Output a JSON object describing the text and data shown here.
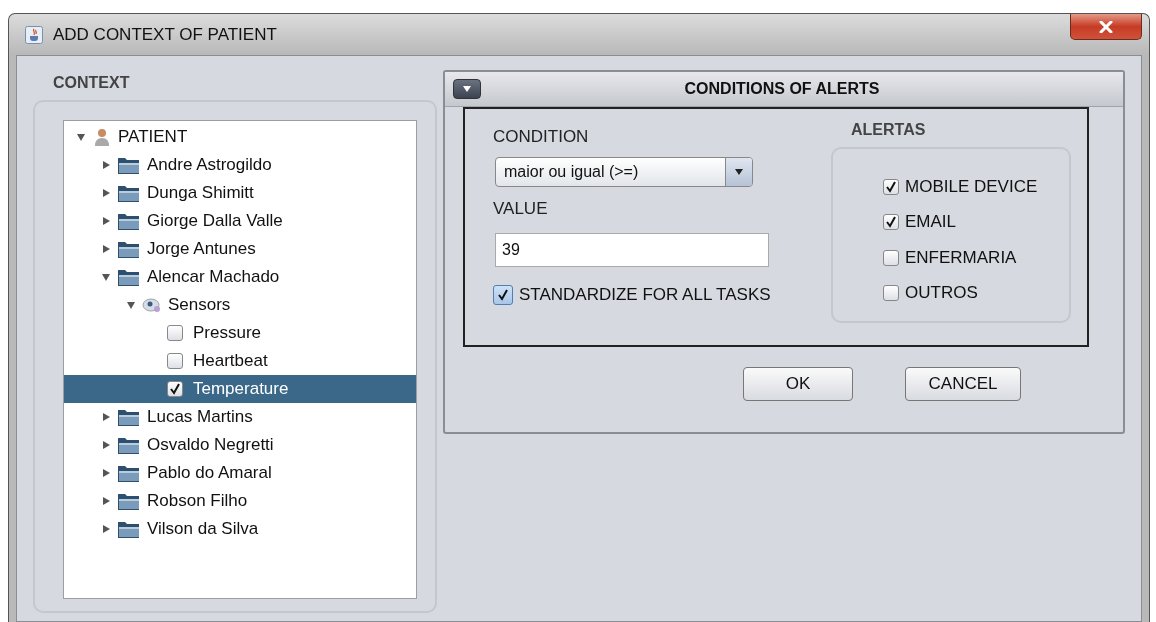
{
  "window": {
    "title": "ADD CONTEXT OF PATIENT"
  },
  "context": {
    "title": "CONTEXT",
    "tree": [
      {
        "label": "PATIENT",
        "kind": "root",
        "expanded": true,
        "selected": false,
        "children": [
          {
            "label": "Andre Astrogildo",
            "kind": "folder",
            "expanded": false,
            "selected": false
          },
          {
            "label": "Dunga Shimitt",
            "kind": "folder",
            "expanded": false,
            "selected": false
          },
          {
            "label": "Giorge Dalla Valle",
            "kind": "folder",
            "expanded": false,
            "selected": false
          },
          {
            "label": "Jorge Antunes",
            "kind": "folder",
            "expanded": false,
            "selected": false
          },
          {
            "label": "Alencar Machado",
            "kind": "folder",
            "expanded": true,
            "selected": false,
            "children": [
              {
                "label": "Sensors",
                "kind": "sensors",
                "expanded": true,
                "selected": false,
                "children": [
                  {
                    "label": "Pressure",
                    "kind": "check",
                    "checked": false,
                    "selected": false
                  },
                  {
                    "label": "Heartbeat",
                    "kind": "check",
                    "checked": false,
                    "selected": false
                  },
                  {
                    "label": "Temperature",
                    "kind": "check",
                    "checked": true,
                    "selected": true
                  }
                ]
              }
            ]
          },
          {
            "label": "Lucas Martins",
            "kind": "folder",
            "expanded": false,
            "selected": false
          },
          {
            "label": "Osvaldo Negretti",
            "kind": "folder",
            "expanded": false,
            "selected": false
          },
          {
            "label": "Pablo do Amaral",
            "kind": "folder",
            "expanded": false,
            "selected": false
          },
          {
            "label": "Robson Filho",
            "kind": "folder",
            "expanded": false,
            "selected": false
          },
          {
            "label": "Vilson da Silva",
            "kind": "folder",
            "expanded": false,
            "selected": false
          }
        ]
      }
    ]
  },
  "alerts_panel": {
    "title": "CONDITIONS OF ALERTS",
    "condition_label": "CONDITION",
    "condition": "maior ou igual (>=)",
    "value_label": "VALUE",
    "value": "39",
    "standardize": {
      "label": "STANDARDIZE FOR ALL TASKS",
      "checked": true
    },
    "alertas": {
      "title": "ALERTAS",
      "options": [
        {
          "label": "MOBILE DEVICE",
          "checked": true
        },
        {
          "label": "EMAIL",
          "checked": true
        },
        {
          "label": "ENFERMARIA",
          "checked": false
        },
        {
          "label": "OUTROS",
          "checked": false
        }
      ]
    }
  },
  "buttons": [
    "OK",
    "CANCEL"
  ]
}
